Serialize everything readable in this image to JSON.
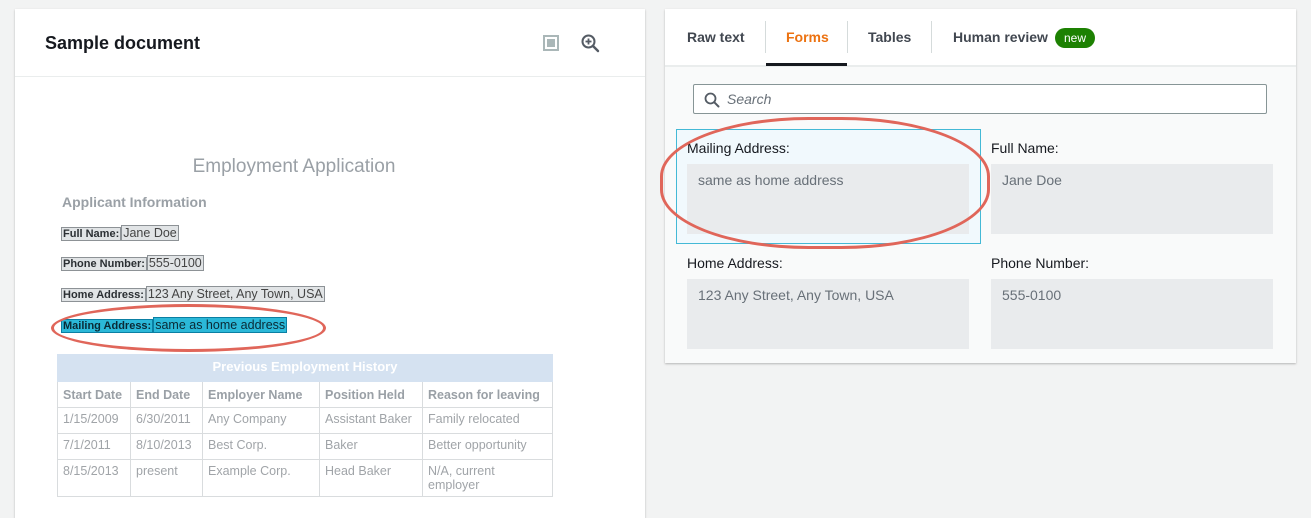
{
  "left": {
    "title": "Sample document",
    "icons": {
      "view": "square-icon",
      "zoom": "zoom-in-icon"
    },
    "document": {
      "heading": "Employment Application",
      "section": "Applicant Information",
      "fields": [
        {
          "key": "Full Name:",
          "value": "Jane Doe"
        },
        {
          "key": "Phone Number:",
          "value": "555-0100"
        },
        {
          "key": "Home Address:",
          "value": "123 Any Street, Any Town, USA"
        },
        {
          "key": "Mailing Address:",
          "value": "same as home address"
        }
      ],
      "table": {
        "caption": "Previous Employment History",
        "headers": [
          "Start Date",
          "End Date",
          "Employer Name",
          "Position Held",
          "Reason for leaving"
        ],
        "rows": [
          [
            "1/15/2009",
            "6/30/2011",
            "Any Company",
            "Assistant Baker",
            "Family relocated"
          ],
          [
            "7/1/2011",
            "8/10/2013",
            "Best Corp.",
            "Baker",
            "Better opportunity"
          ],
          [
            "8/15/2013",
            "present",
            "Example Corp.",
            "Head Baker",
            "N/A, current employer"
          ]
        ]
      }
    }
  },
  "right": {
    "tabs": [
      {
        "label": "Raw text"
      },
      {
        "label": "Forms"
      },
      {
        "label": "Tables"
      },
      {
        "label": "Human review"
      }
    ],
    "badge": "new",
    "search": {
      "placeholder": "Search"
    },
    "pairs": [
      {
        "key": "Mailing Address:",
        "value": "same as home address"
      },
      {
        "key": "Full Name:",
        "value": "Jane Doe"
      },
      {
        "key": "Home Address:",
        "value": "123 Any Street, Any Town, USA"
      },
      {
        "key": "Phone Number:",
        "value": "555-0100"
      }
    ]
  },
  "colors": {
    "accent": "#ec7211",
    "badge": "#1d8102",
    "highlight": "#2bb8d8",
    "annotation": "#e0665a"
  }
}
